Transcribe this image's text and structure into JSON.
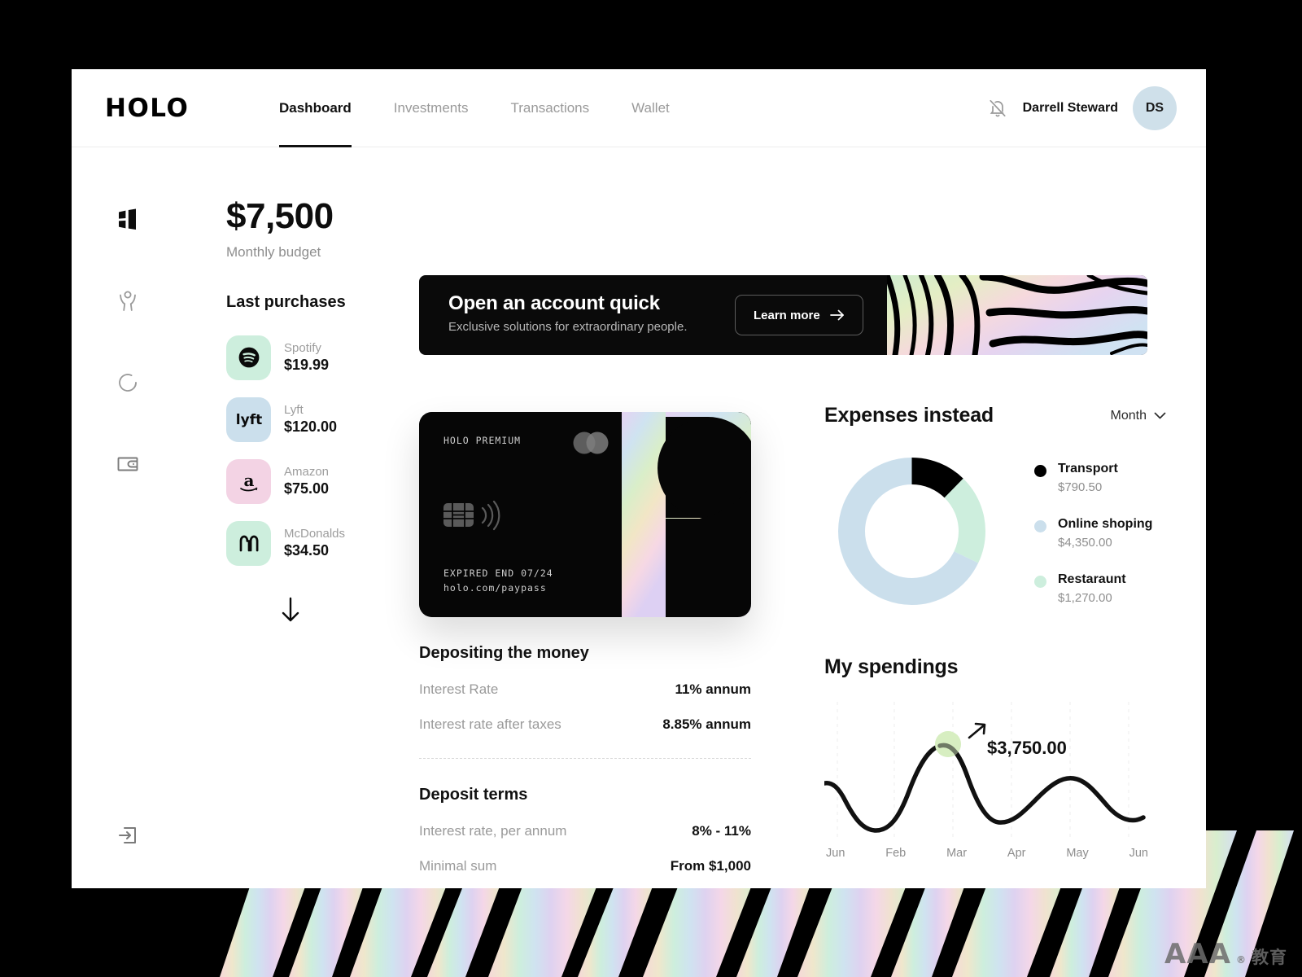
{
  "brand": {
    "logo": "HOLO"
  },
  "nav": {
    "items": [
      {
        "label": "Dashboard",
        "active": true
      },
      {
        "label": "Investments",
        "active": false
      },
      {
        "label": "Transactions",
        "active": false
      },
      {
        "label": "Wallet",
        "active": false
      }
    ]
  },
  "header": {
    "bell_icon": "bell-off-icon",
    "user_name": "Darrell Steward",
    "avatar_initials": "DS",
    "avatar_color": "#cfe0ea"
  },
  "sidebar": {
    "items": [
      {
        "icon": "dashboard-icon",
        "active": true
      },
      {
        "icon": "person-icon",
        "active": false
      },
      {
        "icon": "circle-progress-icon",
        "active": false
      },
      {
        "icon": "wallet-icon",
        "active": false
      }
    ],
    "logout_icon": "logout-icon"
  },
  "budget": {
    "amount": "$7,500",
    "label": "Monthly budget"
  },
  "purchases": {
    "title": "Last purchases",
    "more_icon": "arrow-down-icon",
    "items": [
      {
        "name": "Spotify",
        "amount": "$19.99",
        "icon": "spotify-icon",
        "tile_color": "#cdeedd"
      },
      {
        "name": "Lyft",
        "amount": "$120.00",
        "icon": "lyft-icon",
        "tile_color": "#cbdfec"
      },
      {
        "name": "Amazon",
        "amount": "$75.00",
        "icon": "amazon-icon",
        "tile_color": "#f3d3e4"
      },
      {
        "name": "McDonalds",
        "amount": "$34.50",
        "icon": "mcdonalds-icon",
        "tile_color": "#cdeedd"
      }
    ]
  },
  "banner": {
    "heading": "Open an account quick",
    "subheading": "Exclusive solutions for extraordinary people.",
    "button_label": "Learn more",
    "button_icon": "arrow-right-icon"
  },
  "card": {
    "brand_label": "HOLO PREMIUM",
    "expiry": "EXPIRED END 07/24",
    "url": "holo.com/paypass",
    "scheme_icon": "mastercard-icon",
    "chip_icon": "chip-icon",
    "contactless_icon": "contactless-icon"
  },
  "deposit": {
    "title": "Depositing the money",
    "rows": [
      {
        "key": "Interest Rate",
        "value": "11% annum"
      },
      {
        "key": "Interest rate after taxes",
        "value": "8.85% annum"
      }
    ],
    "terms_title": "Deposit terms",
    "terms_rows": [
      {
        "key": "Interest rate, per annum",
        "value": "8% - 11%"
      },
      {
        "key": "Minimal sum",
        "value": "From $1,000"
      }
    ]
  },
  "expenses": {
    "title": "Expenses instead",
    "period_label": "Month",
    "period_icon": "chevron-down-icon"
  },
  "spendings": {
    "title": "My spendings",
    "callout_value": "$3,750.00",
    "callout_icon": "arrow-up-right-icon"
  },
  "watermark": {
    "text": "AAA",
    "cn": "教育",
    "degree": "®"
  },
  "chart_data": [
    {
      "type": "pie",
      "title": "Expenses instead",
      "subtitle": "Month",
      "legend_position": "right",
      "donut": true,
      "categories": [
        "Transport",
        "Online shoping",
        "Restaraunt"
      ],
      "values": [
        790.5,
        4350.0,
        1270.0
      ],
      "value_labels": [
        "$790.50",
        "$4,350.00",
        "$1,270.00"
      ],
      "colors": [
        "#000000",
        "#cbdfec",
        "#cdeedd"
      ],
      "percentages": [
        12.3,
        67.9,
        19.8
      ]
    },
    {
      "type": "line",
      "title": "My spendings",
      "x": [
        "Jun",
        "Feb",
        "Mar",
        "Apr",
        "May",
        "Jun"
      ],
      "categories": [
        "Jun",
        "Feb",
        "Mar",
        "Apr",
        "May",
        "Jun"
      ],
      "series": [
        {
          "name": "Spendings",
          "values": [
            2100,
            1200,
            3750,
            1300,
            2700,
            1950
          ]
        }
      ],
      "annotations": [
        {
          "x": "Mar",
          "label": "$3,750.00",
          "marker": "highlight-dot"
        }
      ],
      "grid": "vertical-dashed",
      "ylabel": "",
      "xlabel": "",
      "line_color": "#111111",
      "marker_color": "#d8eec2"
    }
  ]
}
